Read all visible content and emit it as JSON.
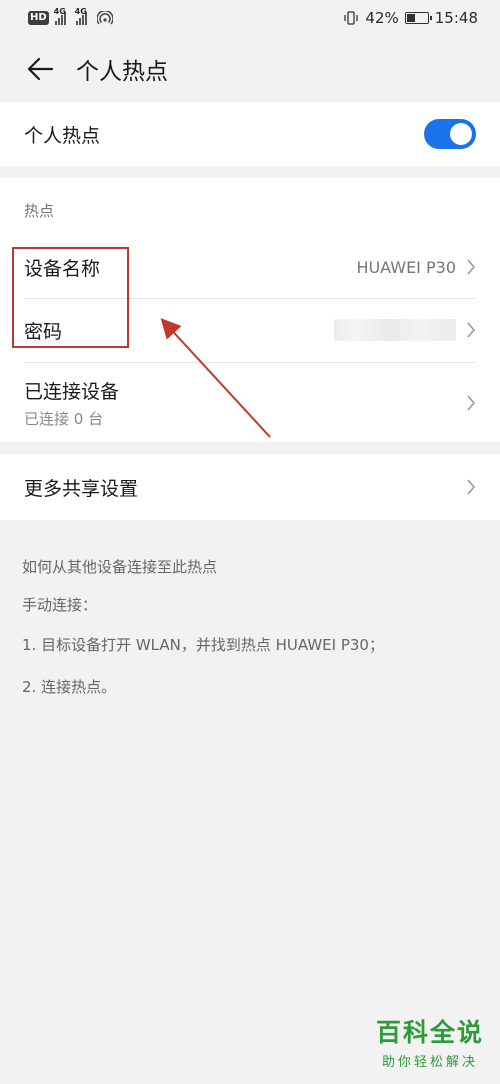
{
  "status_bar": {
    "hd_label": "HD",
    "signal_1_label": "4G",
    "signal_2_label": "4G",
    "battery_percent": "42%",
    "battery_level": 0.42,
    "time": "15:48"
  },
  "app_bar": {
    "title": "个人热点"
  },
  "hotspot_toggle": {
    "label": "个人热点",
    "enabled": true
  },
  "hotspot_section": {
    "title": "热点",
    "device_name": {
      "label": "设备名称",
      "value": "HUAWEI P30"
    },
    "password": {
      "label": "密码",
      "value": ""
    },
    "connected_devices": {
      "label": "已连接设备",
      "sub": "已连接 0 台"
    }
  },
  "more_sharing": {
    "label": "更多共享设置"
  },
  "help": {
    "title": "如何从其他设备连接至此热点",
    "manual": "手动连接：",
    "step1": "1. 目标设备打开 WLAN，并找到热点 HUAWEI P30；",
    "step2": "2. 连接热点。"
  },
  "watermark": {
    "title": "百科全说",
    "subtitle": "助你轻松解决"
  },
  "colors": {
    "accent": "#1a73e8",
    "annotation": "#c0392b",
    "watermark": "#2d9b3a"
  }
}
